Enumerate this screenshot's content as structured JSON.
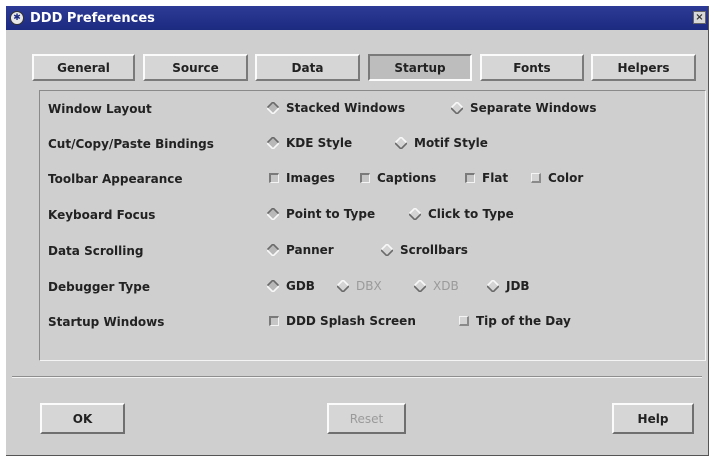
{
  "window": {
    "title": "DDD Preferences",
    "close_glyph": "×",
    "icon": "ddd-app-icon"
  },
  "tabs": [
    {
      "label": "General",
      "active": false
    },
    {
      "label": "Source",
      "active": false
    },
    {
      "label": "Data",
      "active": false
    },
    {
      "label": "Startup",
      "active": true
    },
    {
      "label": "Fonts",
      "active": false
    },
    {
      "label": "Helpers",
      "active": false
    }
  ],
  "settings": {
    "window_layout": {
      "label": "Window Layout",
      "options": [
        {
          "label": "Stacked Windows",
          "selected": true
        },
        {
          "label": "Separate Windows",
          "selected": false
        }
      ]
    },
    "bindings": {
      "label": "Cut/Copy/Paste Bindings",
      "options": [
        {
          "label": "KDE Style",
          "selected": true
        },
        {
          "label": "Motif Style",
          "selected": false
        }
      ]
    },
    "toolbar": {
      "label": "Toolbar Appearance",
      "options": [
        {
          "label": "Images",
          "checked": true
        },
        {
          "label": "Captions",
          "checked": true
        },
        {
          "label": "Flat",
          "checked": true
        },
        {
          "label": "Color",
          "checked": false
        }
      ]
    },
    "keyboard_focus": {
      "label": "Keyboard Focus",
      "options": [
        {
          "label": "Point to Type",
          "selected": true
        },
        {
          "label": "Click to Type",
          "selected": false
        }
      ]
    },
    "data_scrolling": {
      "label": "Data Scrolling",
      "options": [
        {
          "label": "Panner",
          "selected": true
        },
        {
          "label": "Scrollbars",
          "selected": false
        }
      ]
    },
    "debugger_type": {
      "label": "Debugger Type",
      "options": [
        {
          "label": "GDB",
          "selected": true,
          "enabled": true
        },
        {
          "label": "DBX",
          "selected": false,
          "enabled": false
        },
        {
          "label": "XDB",
          "selected": false,
          "enabled": false
        },
        {
          "label": "JDB",
          "selected": false,
          "enabled": true
        }
      ]
    },
    "startup_windows": {
      "label": "Startup Windows",
      "options": [
        {
          "label": "DDD Splash Screen",
          "checked": true
        },
        {
          "label": "Tip of the Day",
          "checked": false
        }
      ]
    }
  },
  "buttons": {
    "ok": {
      "label": "OK",
      "enabled": true
    },
    "reset": {
      "label": "Reset",
      "enabled": false
    },
    "help": {
      "label": "Help",
      "enabled": true
    }
  },
  "colors": {
    "titlebar": "#1c2a80",
    "dialog_bg": "#cfcfcf",
    "disabled_text": "#9a9a9a"
  }
}
